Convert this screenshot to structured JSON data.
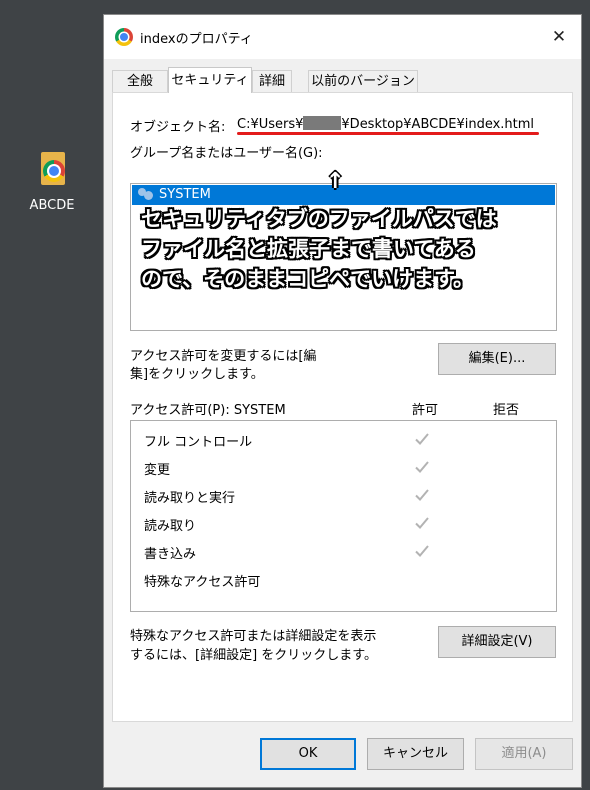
{
  "desktop": {
    "icon_label": "ABCDE"
  },
  "dialog": {
    "title": "indexのプロパティ",
    "close_glyph": "✕",
    "tabs": [
      "全般",
      "セキュリティ",
      "詳細",
      "以前のバージョン"
    ],
    "active_tab": "セキュリティ",
    "object_name_label": "オブジェクト名:",
    "object_path_prefix": "C:¥Users¥",
    "object_path_suffix": "¥Desktop¥ABCDE¥index.html",
    "group_label": "グループ名またはユーザー名(G):",
    "users": [
      {
        "name": "SYSTEM",
        "selected": true
      }
    ],
    "annotation": {
      "arrow": "↑",
      "lines": [
        "セキュリティタブのファイルパスでは",
        "ファイル名と拡張子まで書いてある",
        "ので、そのままコピペでいけます。"
      ]
    },
    "change_desc_line1": "アクセス許可を変更するには[編",
    "change_desc_line2": "集]をクリックします。",
    "edit_button": "編集(E)...",
    "perm_header": "アクセス許可(P): SYSTEM",
    "allow_header": "許可",
    "deny_header": "拒否",
    "permissions": [
      {
        "name": "フル コントロール",
        "allow": true
      },
      {
        "name": "変更",
        "allow": true
      },
      {
        "name": "読み取りと実行",
        "allow": true
      },
      {
        "name": "読み取り",
        "allow": true
      },
      {
        "name": "書き込み",
        "allow": true
      },
      {
        "name": "特殊なアクセス許可",
        "allow": false
      }
    ],
    "advanced_desc_line1": "特殊なアクセス許可または詳細設定を表示",
    "advanced_desc_line2": "するには、[詳細設定] をクリックします。",
    "advanced_button": "詳細設定(V)",
    "ok_button": "OK",
    "cancel_button": "キャンセル",
    "apply_button": "適用(A)"
  },
  "colors": {
    "selection": "#0078d7",
    "annotation_underline": "#e31b1b",
    "check": "#b3b3b3"
  }
}
